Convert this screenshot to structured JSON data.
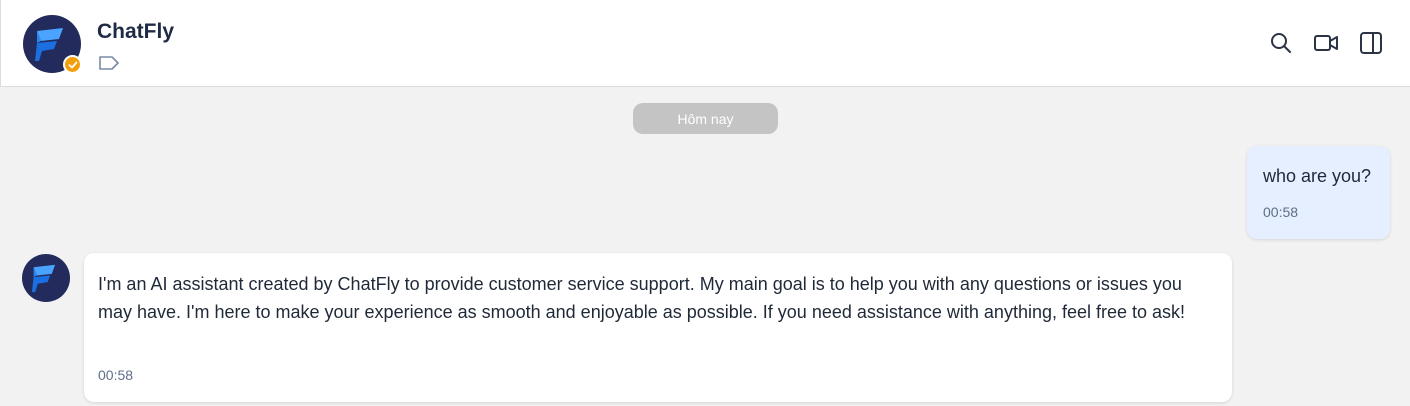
{
  "header": {
    "title": "ChatFly",
    "avatar_icon": "chatfly-logo-icon",
    "badge_icon": "verified-check-icon",
    "tag_icon": "label-tag-icon",
    "actions": [
      {
        "icon": "search-icon"
      },
      {
        "icon": "video-camera-icon"
      },
      {
        "icon": "split-panel-icon"
      }
    ]
  },
  "conversation": {
    "date_separator": "Hôm nay",
    "messages": [
      {
        "sender": "user",
        "text": "who are you?",
        "time": "00:58"
      },
      {
        "sender": "bot",
        "text": "I'm an AI assistant created by ChatFly to provide customer service support. My main goal is to help you with any questions or issues you may have. I'm here to make your experience as smooth and enjoyable as possible. If you need assistance with anything, feel free to ask!",
        "time": "00:58"
      }
    ]
  },
  "colors": {
    "avatar_bg": "#232a5c",
    "logo_light": "#4aa3ff",
    "logo_dark": "#1c6fe0",
    "badge": "#f59e0b",
    "user_bubble": "#e6efff",
    "chat_bg": "#f2f2f2"
  }
}
